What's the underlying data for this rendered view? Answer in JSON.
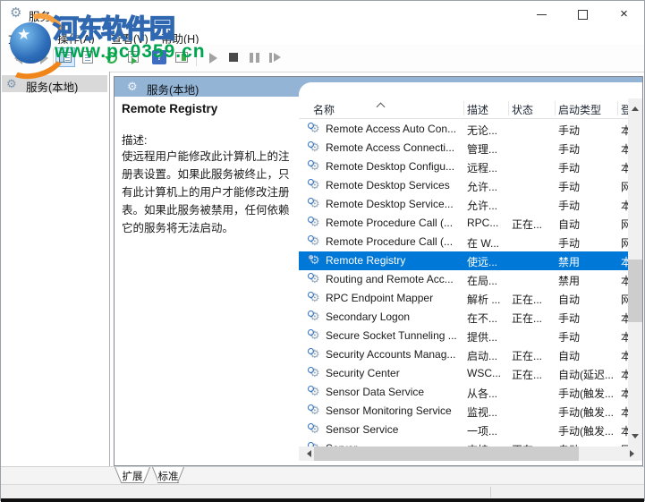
{
  "window": {
    "title": "服务"
  },
  "icons": {
    "gear_glyph": "⚙",
    "help_glyph": "?",
    "close_glyph": "×",
    "star_glyph": "★"
  },
  "menu": {
    "items": [
      "文件(F)",
      "操作(A)",
      "查看(V)",
      "帮助(H)"
    ]
  },
  "toolbar": {
    "buttons": [
      "back",
      "forward",
      "show-console-tree",
      "properties",
      "refresh",
      "export-list",
      "help",
      "extended-view",
      "start-service",
      "stop-service",
      "pause-service",
      "restart-service"
    ]
  },
  "tree": {
    "selected_item": "服务(本地)"
  },
  "main": {
    "banner_title": "服务(本地)",
    "selected_service": {
      "name": "Remote Registry",
      "description_label": "描述:",
      "description": "使远程用户能修改此计算机上的注册表设置。如果此服务被终止，只有此计算机上的用户才能修改注册表。如果此服务被禁用，任何依赖它的服务将无法启动。"
    },
    "list": {
      "columns": [
        "名称",
        "描述",
        "状态",
        "启动类型",
        "登"
      ],
      "rows": [
        {
          "name": "Remote Access Auto Con...",
          "desc": "无论...",
          "status": "",
          "startup": "手动",
          "logon": "本",
          "selected": false
        },
        {
          "name": "Remote Access Connecti...",
          "desc": "管理...",
          "status": "",
          "startup": "手动",
          "logon": "本",
          "selected": false
        },
        {
          "name": "Remote Desktop Configu...",
          "desc": "远程...",
          "status": "",
          "startup": "手动",
          "logon": "本",
          "selected": false
        },
        {
          "name": "Remote Desktop Services",
          "desc": "允许...",
          "status": "",
          "startup": "手动",
          "logon": "网",
          "selected": false
        },
        {
          "name": "Remote Desktop Service...",
          "desc": "允许...",
          "status": "",
          "startup": "手动",
          "logon": "本",
          "selected": false
        },
        {
          "name": "Remote Procedure Call (...",
          "desc": "RPC...",
          "status": "正在...",
          "startup": "自动",
          "logon": "网",
          "selected": false
        },
        {
          "name": "Remote Procedure Call (...",
          "desc": "在 W...",
          "status": "",
          "startup": "手动",
          "logon": "网",
          "selected": false
        },
        {
          "name": "Remote Registry",
          "desc": "使远...",
          "status": "",
          "startup": "禁用",
          "logon": "本",
          "selected": true
        },
        {
          "name": "Routing and Remote Acc...",
          "desc": "在局...",
          "status": "",
          "startup": "禁用",
          "logon": "本",
          "selected": false
        },
        {
          "name": "RPC Endpoint Mapper",
          "desc": "解析 ...",
          "status": "正在...",
          "startup": "自动",
          "logon": "网",
          "selected": false
        },
        {
          "name": "Secondary Logon",
          "desc": "在不...",
          "status": "正在...",
          "startup": "手动",
          "logon": "本",
          "selected": false
        },
        {
          "name": "Secure Socket Tunneling ...",
          "desc": "提供...",
          "status": "",
          "startup": "手动",
          "logon": "本",
          "selected": false
        },
        {
          "name": "Security Accounts Manag...",
          "desc": "启动...",
          "status": "正在...",
          "startup": "自动",
          "logon": "本",
          "selected": false
        },
        {
          "name": "Security Center",
          "desc": "WSC...",
          "status": "正在...",
          "startup": "自动(延迟...",
          "logon": "本",
          "selected": false
        },
        {
          "name": "Sensor Data Service",
          "desc": "从各...",
          "status": "",
          "startup": "手动(触发...",
          "logon": "本",
          "selected": false
        },
        {
          "name": "Sensor Monitoring Service",
          "desc": "监视...",
          "status": "",
          "startup": "手动(触发...",
          "logon": "本",
          "selected": false
        },
        {
          "name": "Sensor Service",
          "desc": "一项...",
          "status": "",
          "startup": "手动(触发...",
          "logon": "本",
          "selected": false
        },
        {
          "name": "Server",
          "desc": "支持...",
          "status": "正在...",
          "startup": "自动",
          "logon": "网",
          "selected": false,
          "partial": true
        }
      ]
    }
  },
  "tabs": {
    "items": [
      "扩展",
      "标准"
    ],
    "active": "扩展"
  },
  "watermark": {
    "site_name": "河东软件园",
    "site_url": "www.pc0359.cn"
  },
  "colors": {
    "selection_blue": "#0078d7",
    "banner_blue": "#93b4d5",
    "watermark_orange": "#ffa200",
    "watermark_green": "#00a550"
  }
}
